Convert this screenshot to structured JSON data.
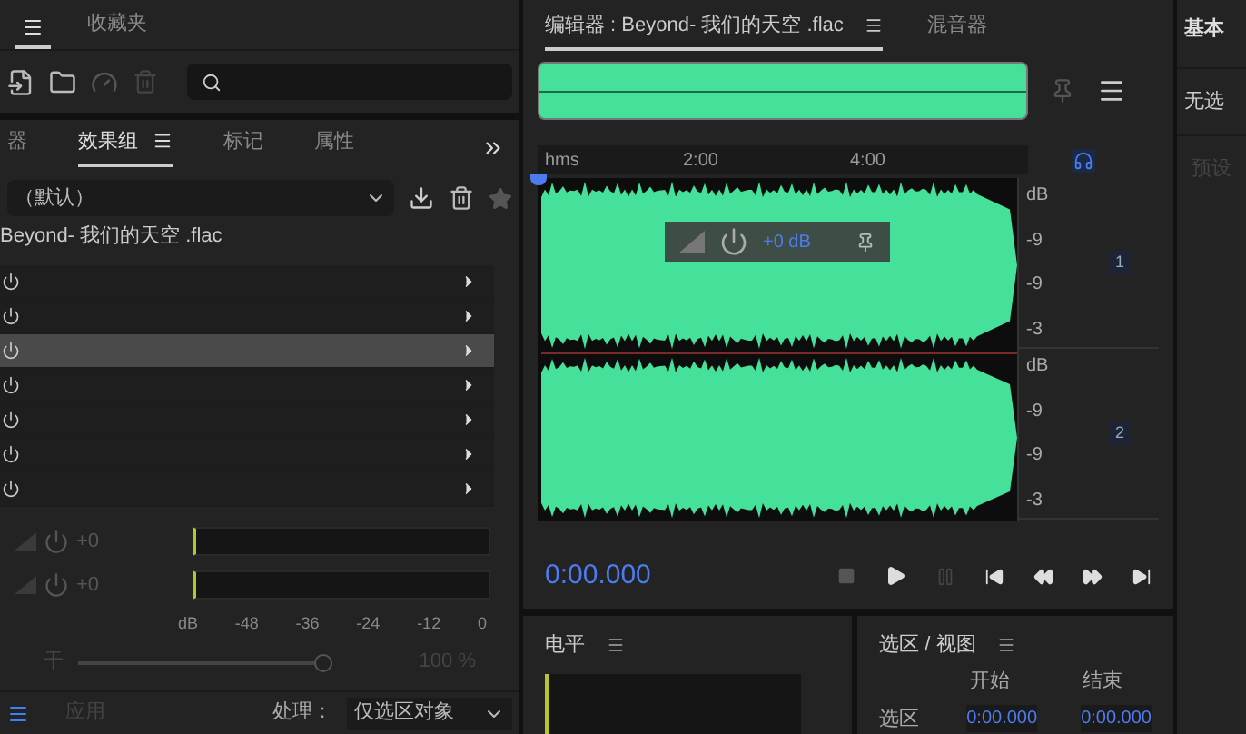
{
  "left_top_tabs": [
    {
      "kind": "menu",
      "selected": true
    },
    {
      "kind": "label",
      "label": "收藏夹",
      "selected": false
    }
  ],
  "effects_panel": {
    "tabs": [
      {
        "label": "器",
        "selected": false,
        "menu": false
      },
      {
        "label": "效果组",
        "selected": true,
        "menu": true
      },
      {
        "label": "标记",
        "selected": false,
        "menu": false
      },
      {
        "label": "属性",
        "selected": false,
        "menu": false
      }
    ],
    "preset": "（默认）",
    "file": "Beyond- 我们的天空 .flac",
    "slots": [
      {
        "selected": false
      },
      {
        "selected": false
      },
      {
        "selected": true
      },
      {
        "selected": false
      },
      {
        "selected": false
      },
      {
        "selected": false
      },
      {
        "selected": false
      }
    ],
    "gains": [
      {
        "value": "+0"
      },
      {
        "value": "+0"
      }
    ],
    "scale": [
      "dB",
      "-48",
      "-36",
      "-24",
      "-12",
      "0"
    ],
    "mix": {
      "label": "干",
      "level": 1,
      "reading": "100 %"
    },
    "apply": "应用",
    "process_label": "处理：",
    "process_value": "仅选区对象"
  },
  "editor": {
    "tabs": [
      {
        "label": "编辑器 : Beyond- 我们的天空 .flac",
        "selected": true,
        "menu": true
      },
      {
        "label": "混音器",
        "selected": false,
        "menu": false
      }
    ],
    "ruler": [
      "hms",
      "2:00",
      "4:00"
    ],
    "hud_gain": "+0 dB",
    "channels": [
      {
        "number": "1",
        "scale": [
          "dB",
          "-9",
          "-9",
          "-3"
        ]
      },
      {
        "number": "2",
        "scale": [
          "dB",
          "-9",
          "-9",
          "-3"
        ]
      }
    ],
    "time": "0:00.000"
  },
  "levels_panel": {
    "title": "电平"
  },
  "selection_panel": {
    "title": "选区 / 视图",
    "columns": [
      "开始",
      "结束"
    ],
    "row_label": "选区",
    "start": "0:00.000",
    "end": "0:00.000"
  },
  "right_panel": {
    "title": "基本",
    "status": "无选",
    "hint": "预设"
  }
}
